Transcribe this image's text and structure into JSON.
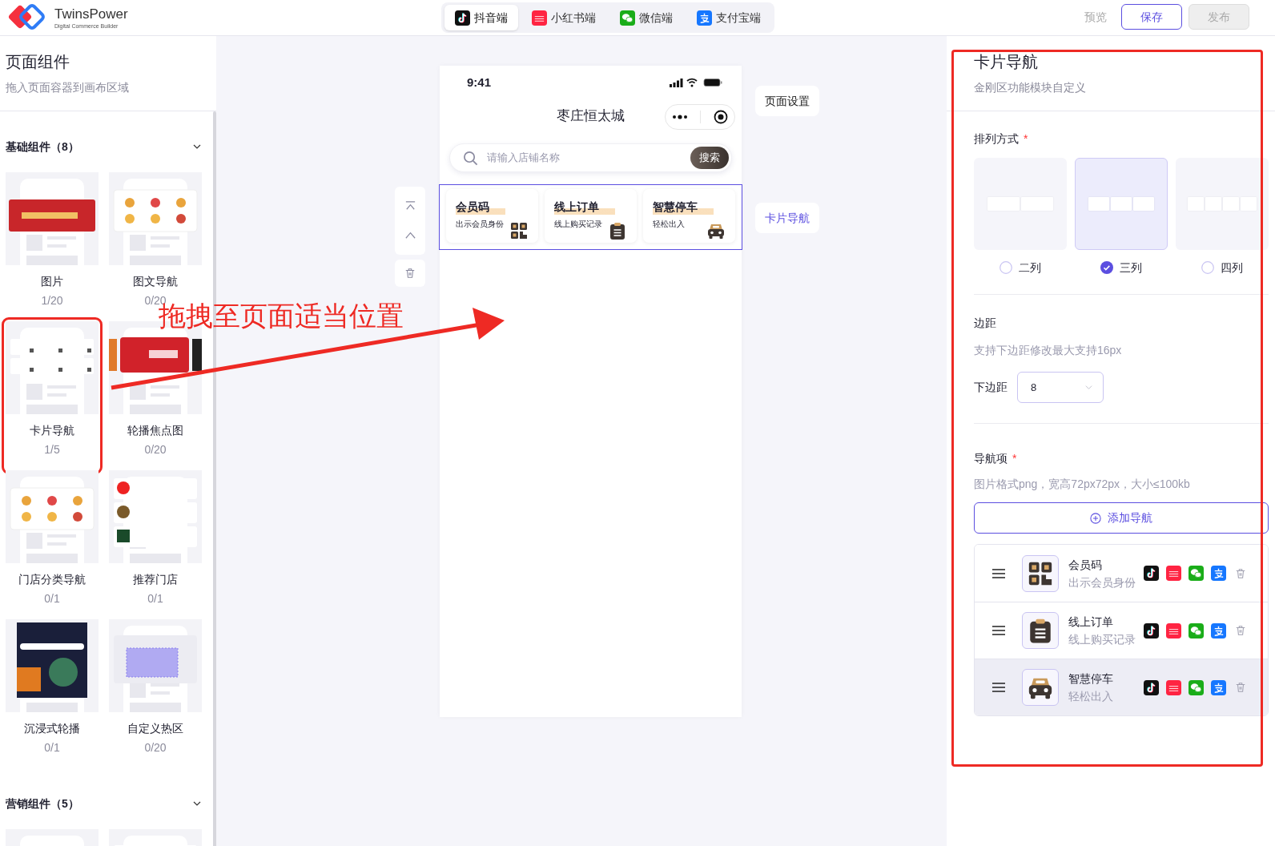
{
  "app": {
    "name": "TwinsPower",
    "tagline": "Digital Commerce Builder"
  },
  "platform_tabs": [
    {
      "label": "抖音端",
      "kind": "douyin",
      "selected": true
    },
    {
      "label": "小红书端",
      "kind": "xhs",
      "selected": false
    },
    {
      "label": "微信端",
      "kind": "wechat",
      "selected": false
    },
    {
      "label": "支付宝端",
      "kind": "alipay",
      "selected": false
    }
  ],
  "header_actions": {
    "preview": "预览",
    "save": "保存",
    "publish": {
      "label": "发布",
      "disabled": true
    }
  },
  "sidebar": {
    "title": "页面组件",
    "subtitle": "拖入页面容器到画布区域",
    "sections": [
      {
        "title": "基础组件（8）",
        "expanded": true,
        "items": [
          {
            "label": "图片",
            "count": "1/20",
            "kind": "banner",
            "selected": false
          },
          {
            "label": "图文导航",
            "count": "0/20",
            "kind": "icons",
            "selected": false
          },
          {
            "label": "卡片导航",
            "count": "1/5",
            "kind": "cards",
            "selected": true
          },
          {
            "label": "轮播焦点图",
            "count": "0/20",
            "kind": "carousel",
            "selected": false
          },
          {
            "label": "门店分类导航",
            "count": "0/1",
            "kind": "icons",
            "selected": false
          },
          {
            "label": "推荐门店",
            "count": "0/1",
            "kind": "list",
            "selected": false
          },
          {
            "label": "沉浸式轮播",
            "count": "0/1",
            "kind": "immersive",
            "selected": false
          },
          {
            "label": "自定义热区",
            "count": "0/20",
            "kind": "hotspot",
            "selected": false
          }
        ]
      },
      {
        "title": "营销组件（5）",
        "expanded": true,
        "items": [
          {
            "kind": "coupon",
            "selected": false
          },
          {
            "kind": "flash",
            "selected": false
          }
        ]
      }
    ]
  },
  "phone": {
    "time": "9:41",
    "title": "枣庄恒太城",
    "search": {
      "placeholder": "请输入店铺名称",
      "button": "搜索"
    },
    "cards": [
      {
        "title": "会员码",
        "subtitle": "出示会员身份",
        "kind": "qr"
      },
      {
        "title": "线上订单",
        "subtitle": "线上购买记录",
        "kind": "order"
      },
      {
        "title": "智慧停车",
        "subtitle": "轻松出入",
        "kind": "car"
      }
    ]
  },
  "canvas_callouts": [
    {
      "label": "页面设置",
      "selected": false
    },
    {
      "label": "卡片导航",
      "selected": true
    }
  ],
  "settings": {
    "title": "卡片导航",
    "subtitle": "金刚区功能模块自定义",
    "layout": {
      "label": "排列方式",
      "required_mark": "*",
      "options": [
        {
          "label": "二列",
          "kind": "two",
          "selected": false
        },
        {
          "label": "三列",
          "kind": "three",
          "selected": true
        },
        {
          "label": "四列",
          "kind": "four",
          "selected": false
        }
      ]
    },
    "margin": {
      "label": "边距",
      "help": "支持下边距修改最大支持16px",
      "field_label": "下边距",
      "value": "8"
    },
    "nav": {
      "label": "导航项",
      "required_mark": "*",
      "help": "图片格式png，宽高72px72px，大小≤100kb",
      "add_button": "添加导航",
      "items": [
        {
          "title": "会员码",
          "subtitle": "出示会员身份",
          "kind": "qr",
          "hovered": false
        },
        {
          "title": "线上订单",
          "subtitle": "线上购买记录",
          "kind": "order",
          "hovered": false
        },
        {
          "title": "智慧停车",
          "subtitle": "轻松出入",
          "kind": "car",
          "hovered": true
        }
      ]
    }
  },
  "annotation": {
    "text": "拖拽至页面适当位置"
  }
}
